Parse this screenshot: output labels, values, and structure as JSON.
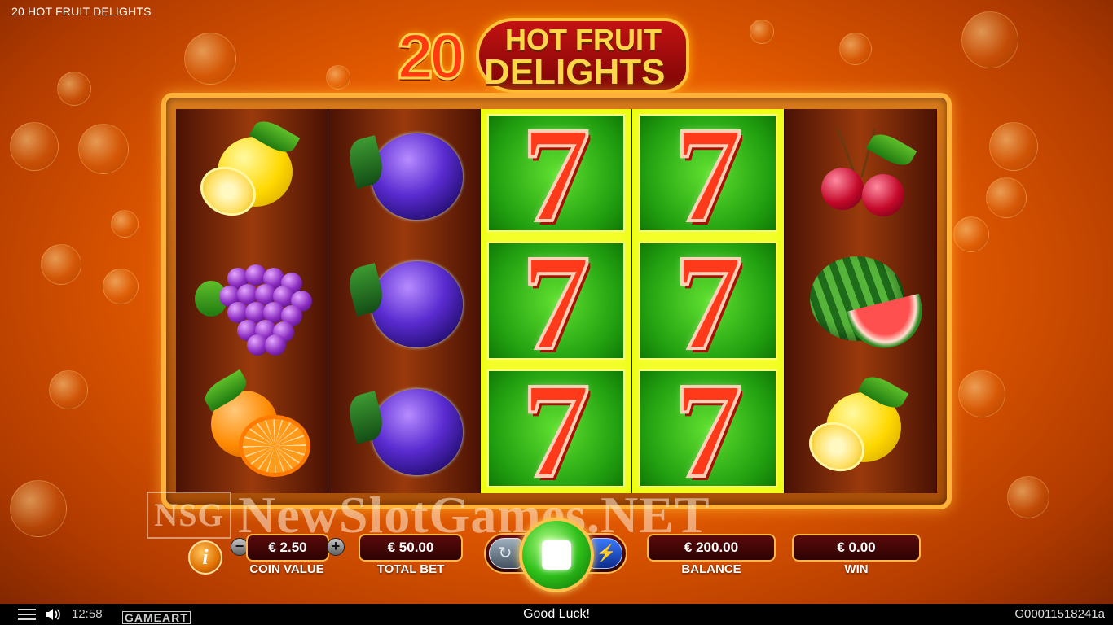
{
  "window": {
    "title": "20 HOT FRUIT DELIGHTS"
  },
  "logo": {
    "number": "20",
    "line1": "HOT FRUIT",
    "line2": "DELIGHTS"
  },
  "reels": [
    [
      "lemon",
      "grapes",
      "orange"
    ],
    [
      "plum",
      "plum",
      "plum"
    ],
    [
      "seven",
      "seven",
      "seven"
    ],
    [
      "seven",
      "seven",
      "seven"
    ],
    [
      "cherries",
      "watermelon",
      "lemon"
    ]
  ],
  "reel_highlight": [
    false,
    false,
    true,
    true,
    false
  ],
  "seven_glyph": "7",
  "watermark": {
    "badge": "NSG",
    "text": "NewSlotGames.NET"
  },
  "controls": {
    "info_glyph": "i",
    "coin_value": {
      "value": "€ 2.50",
      "label": "COIN VALUE",
      "minus": "−",
      "plus": "+"
    },
    "total_bet": {
      "value": "€ 50.00",
      "label": "TOTAL BET"
    },
    "balance": {
      "value": "€ 200.00",
      "label": "BALANCE"
    },
    "win": {
      "value": "€ 0.00",
      "label": "WIN"
    },
    "autoplay_glyph": "↻",
    "turbo_glyph": "⚡"
  },
  "bottom_bar": {
    "time": "12:58",
    "brand": "GAMEART",
    "status": "Good Luck!",
    "game_id": "G00011518241a"
  },
  "colors": {
    "accent_gold": "#ffb84a",
    "panel_dark_red": "#5a0a0a",
    "spin_green": "#2fc01a",
    "win_yellow": "#f4ff2a"
  }
}
